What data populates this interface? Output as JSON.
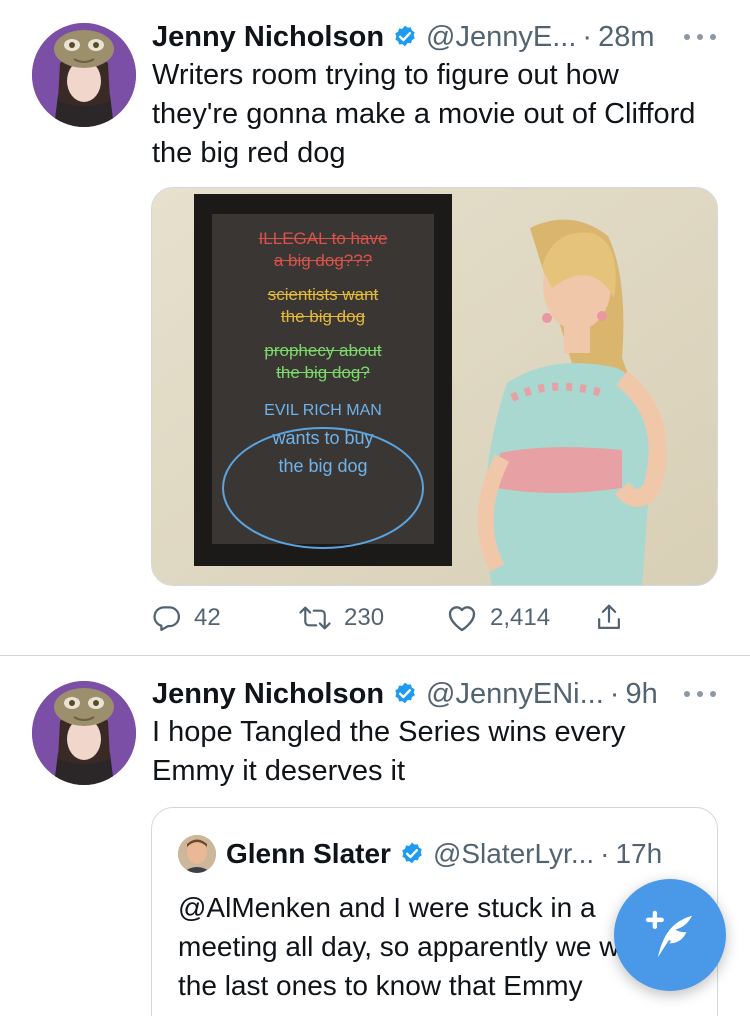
{
  "tweets": [
    {
      "author_name": "Jenny Nicholson",
      "handle": "@JennyE...",
      "separator": "·",
      "time": "28m",
      "text": "Writers room trying to figure out how they're gonna make a movie out of Clifford the big red dog",
      "media": {
        "board_lines": [
          {
            "text": "ILLEGAL to have",
            "color": "#d9524b"
          },
          {
            "text": "a big dog???",
            "color": "#d9524b"
          },
          {
            "text": "scientists want",
            "color": "#e3b93a"
          },
          {
            "text": "the big dog",
            "color": "#e3b93a"
          },
          {
            "text": "prophecy about",
            "color": "#7cd86a"
          },
          {
            "text": "the big dog?",
            "color": "#7cd86a"
          },
          {
            "text": "EVIL RICH MAN",
            "color": "#6fb3ea"
          },
          {
            "text": "wants to buy",
            "color": "#6fb3ea"
          },
          {
            "text": "the big dog",
            "color": "#6fb3ea"
          }
        ]
      },
      "actions": {
        "replies": "42",
        "retweets": "230",
        "likes": "2,414"
      }
    },
    {
      "author_name": "Jenny Nicholson",
      "handle": "@JennyENi...",
      "separator": "·",
      "time": "9h",
      "text": "I hope Tangled the Series wins every Emmy it deserves it",
      "quote": {
        "author_name": "Glenn Slater",
        "handle": "@SlaterLyr...",
        "separator": "·",
        "time": "17h",
        "text": "@AlMenken and I were stuck in a meeting all day, so apparently we were the last ones to know that Emmy"
      }
    }
  ],
  "colors": {
    "accent": "#1d9bf0",
    "fab": "#4a99e9",
    "secondary_text": "#536471"
  },
  "icons": {
    "reply": "speech-bubble-icon",
    "retweet": "retweet-arrows-icon",
    "like": "heart-icon",
    "share": "share-upload-icon",
    "compose": "feather-plus-icon"
  }
}
